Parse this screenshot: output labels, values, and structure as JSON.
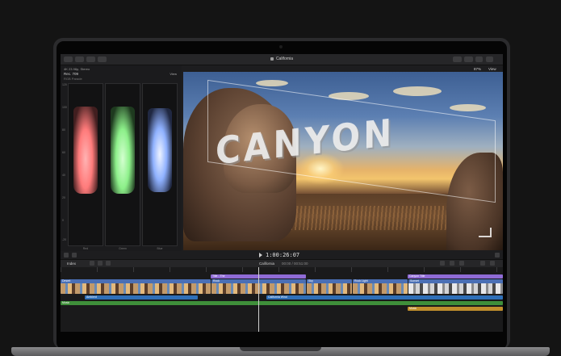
{
  "window": {
    "title": "California",
    "library_label": "4K 23.98p, Stereo",
    "zoom": "87%",
    "view_label": "View"
  },
  "scopes": {
    "title": "Rec. 709",
    "subtitle": "RGB Parade",
    "view_label": "View",
    "y_ticks": [
      "120",
      "100",
      "80",
      "60",
      "40",
      "20",
      "0",
      "-20"
    ],
    "channels": [
      {
        "name": "Red",
        "color": "#ff7b7b"
      },
      {
        "name": "Green",
        "color": "#8df08a"
      },
      {
        "name": "Blue",
        "color": "#8fb1ff"
      }
    ]
  },
  "viewer": {
    "overlay_text": "CANYON",
    "timecode": "1:00:26:07"
  },
  "timeline_toolbar": {
    "index_label": "Index",
    "project_name": "California",
    "project_duration": "00:00 / 00:51:00"
  },
  "timeline": {
    "clips_top": [
      {
        "title": "Title - The",
        "color": "#8f6bd6"
      },
      {
        "title": "Canyon Title",
        "color": "#8f6bd6"
      }
    ],
    "clips_primary": [
      {
        "title": "Desert",
        "color": "#4a6fb5"
      },
      {
        "title": "Rock",
        "color": "#4a6fb5"
      },
      {
        "title": "Sky",
        "color": "#4a6fb5"
      },
      {
        "title": "Rock Light",
        "color": "#4a6fb5"
      },
      {
        "title": "Sunset",
        "color": "#4a6fb5"
      }
    ],
    "clips_audio": [
      {
        "title": "Ambient",
        "color": "#2f6fb8"
      },
      {
        "title": "California Wind",
        "color": "#2f6fb8"
      }
    ],
    "clips_music": [
      {
        "title": "Music",
        "color": "#3f8f3a"
      },
      {
        "title": "Music",
        "color": "#c18f2c"
      }
    ]
  }
}
